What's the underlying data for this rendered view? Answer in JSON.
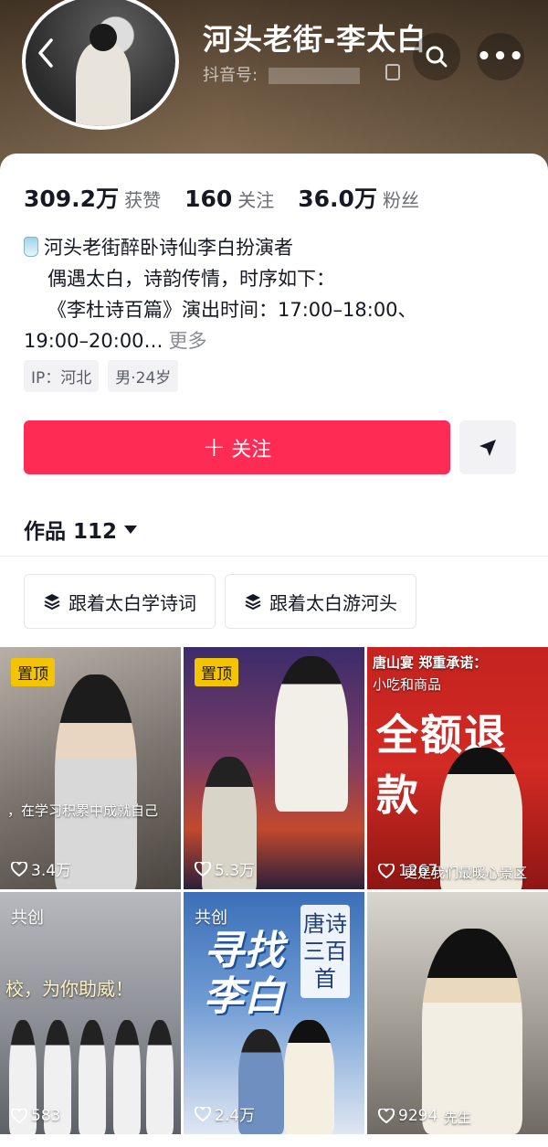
{
  "header": {
    "nickname": "河头老街-李太白",
    "douyin_id_label": "抖音号: ",
    "back_icon": "chevron-left-icon",
    "search_icon": "search-icon",
    "more_icon": "more-icon",
    "more_glyph": "•••"
  },
  "stats": [
    {
      "value": "309.2万",
      "label": "获赞"
    },
    {
      "value": "160",
      "label": "关注"
    },
    {
      "value": "36.0万",
      "label": "粉丝"
    }
  ],
  "bio": {
    "line1": "河头老街醉卧诗仙李白扮演者",
    "line2": "偶遇太白，诗韵传情，时序如下：",
    "line3": "《李杜诗百篇》演出时间：17:00–18:00、",
    "line4": "19:00–20:00…",
    "more": "更多"
  },
  "tags": [
    "IP：河北",
    "男·24岁"
  ],
  "actions": {
    "follow_label": "关注",
    "follow_plus": "+"
  },
  "works": {
    "label": "作品 112"
  },
  "collections": [
    "跟着太白学诗词",
    "跟着太白游河头"
  ],
  "videos": [
    {
      "badge": "置顶",
      "likes": "3.4万",
      "caption": "，在学习积累中成就自己"
    },
    {
      "badge": "置顶",
      "likes": "5.3万"
    },
    {
      "likes": "1267",
      "caption": "更是我们最暖心景区",
      "top_text": "唐山宴 郑重承诺：",
      "sub_text": "小吃和商品",
      "big_text": "全额退款"
    },
    {
      "badge2": "共创",
      "likes": "583",
      "caption": "校，为你助威！"
    },
    {
      "badge2": "共创",
      "likes": "2.4万",
      "title_text": "寻找李白",
      "poem_text": "唐诗三百首"
    },
    {
      "likes": "9294",
      "caption": "先生"
    }
  ],
  "colors": {
    "accent": "#fe2c55",
    "badge": "#f5c400"
  }
}
